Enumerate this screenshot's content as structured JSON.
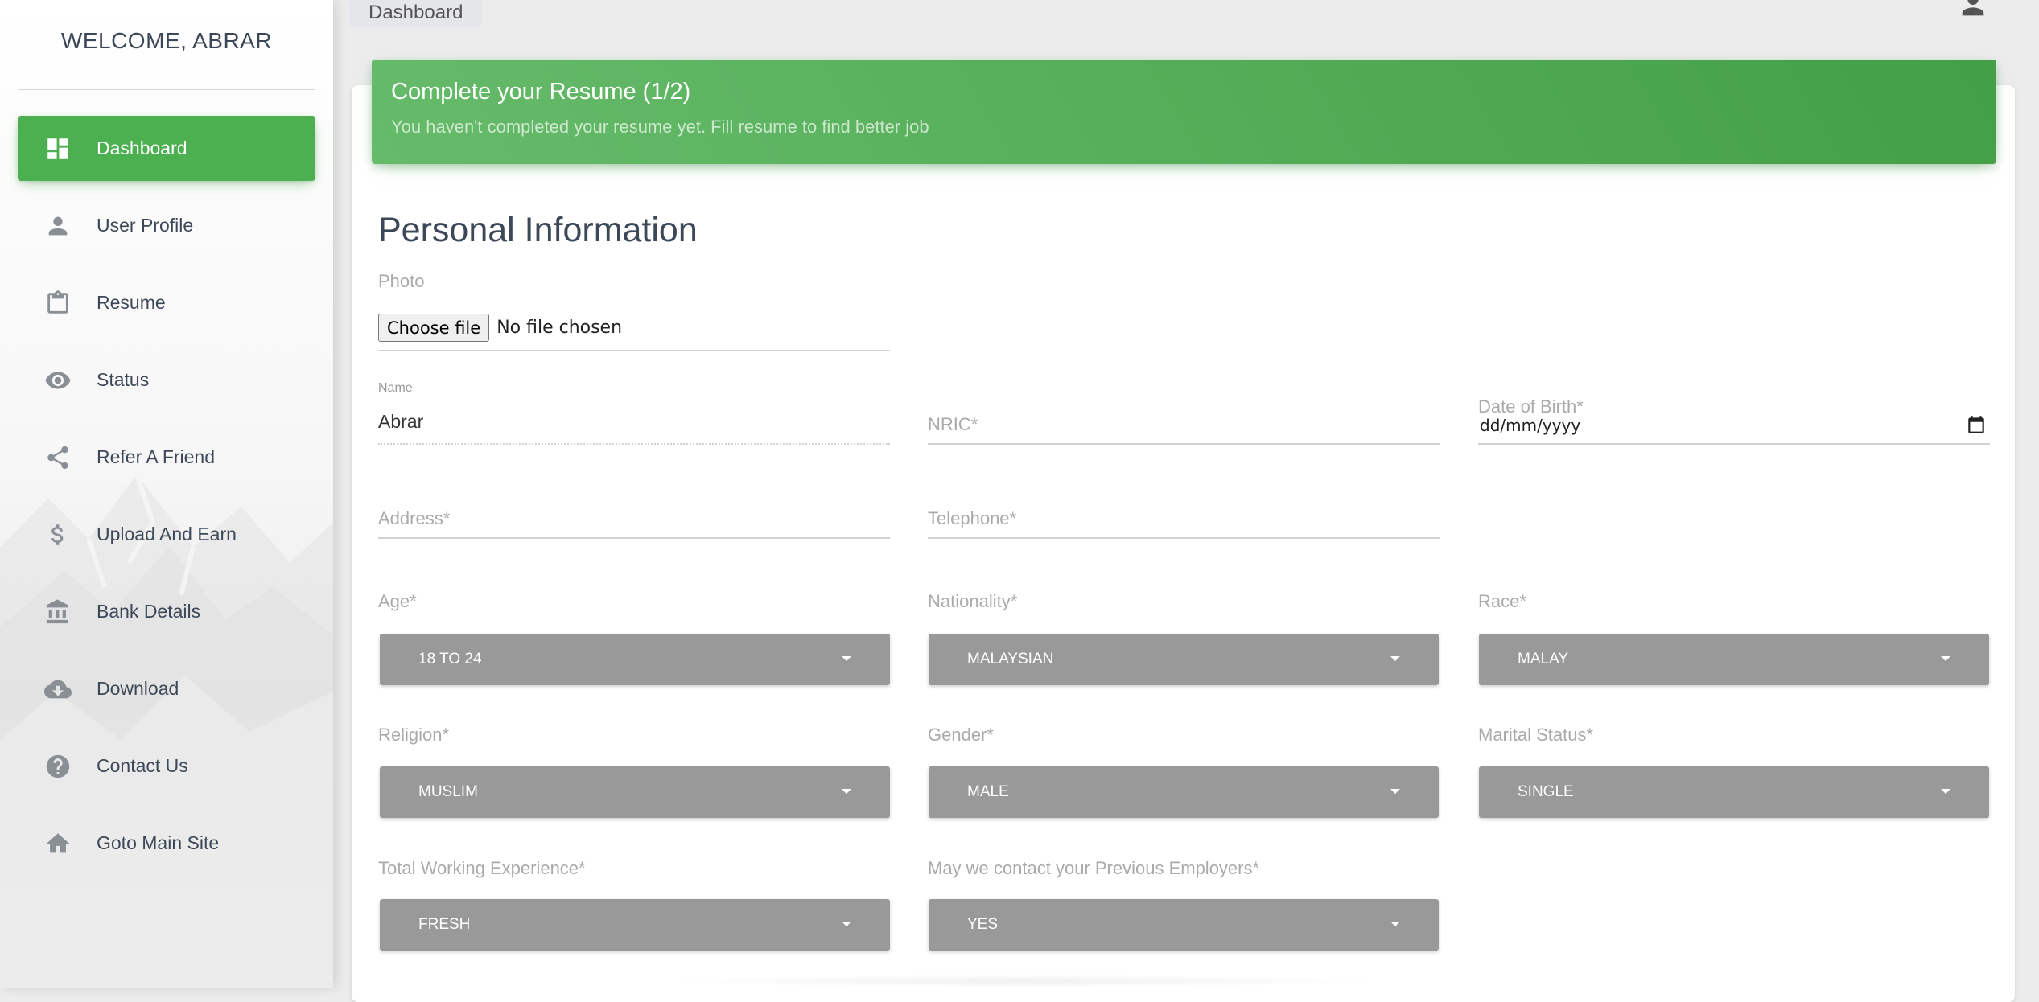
{
  "sidebar": {
    "welcome": "WELCOME, ABRAR",
    "items": [
      {
        "label": "Dashboard",
        "icon": "dashboard-icon",
        "active": true
      },
      {
        "label": "User Profile",
        "icon": "person-icon"
      },
      {
        "label": "Resume",
        "icon": "clipboard-icon"
      },
      {
        "label": "Status",
        "icon": "eye-icon"
      },
      {
        "label": "Refer A Friend",
        "icon": "share-icon"
      },
      {
        "label": "Upload And Earn",
        "icon": "dollar-icon"
      },
      {
        "label": "Bank Details",
        "icon": "bank-icon"
      },
      {
        "label": "Download",
        "icon": "cloud-download-icon"
      },
      {
        "label": "Contact Us",
        "icon": "help-icon"
      },
      {
        "label": "Goto Main Site",
        "icon": "home-icon"
      }
    ]
  },
  "topbar": {
    "breadcrumb": "Dashboard",
    "user_icon": "person-icon"
  },
  "card": {
    "title": "Complete your Resume (1/2)",
    "subtitle": "You haven't completed your resume yet. Fill resume to find better job"
  },
  "form": {
    "section_title": "Personal Information",
    "photo": {
      "label": "Photo",
      "button": "Choose file",
      "status": "No file chosen"
    },
    "name": {
      "label": "Name",
      "value": "Abrar"
    },
    "nric": {
      "placeholder": "NRIC*"
    },
    "dob": {
      "label": "Date of Birth*",
      "value": "dd/mm/yyyy"
    },
    "address": {
      "placeholder": "Address*"
    },
    "telephone": {
      "placeholder": "Telephone*"
    },
    "age": {
      "label": "Age*",
      "value": "18 TO 24"
    },
    "nationality": {
      "label": "Nationality*",
      "value": "MALAYSIAN"
    },
    "race": {
      "label": "Race*",
      "value": "MALAY"
    },
    "religion": {
      "label": "Religion*",
      "value": "MUSLIM"
    },
    "gender": {
      "label": "Gender*",
      "value": "MALE"
    },
    "marital_status": {
      "label": "Marital Status*",
      "value": "SINGLE"
    },
    "experience": {
      "label": "Total Working Experience*",
      "value": "FRESH"
    },
    "contact_employers": {
      "label": "May we contact your Previous Employers*",
      "value": "YES"
    }
  },
  "colors": {
    "accent": "#4caf50",
    "select_bg": "#999999",
    "text": "#3c4858",
    "muted": "#aaaaaa"
  }
}
